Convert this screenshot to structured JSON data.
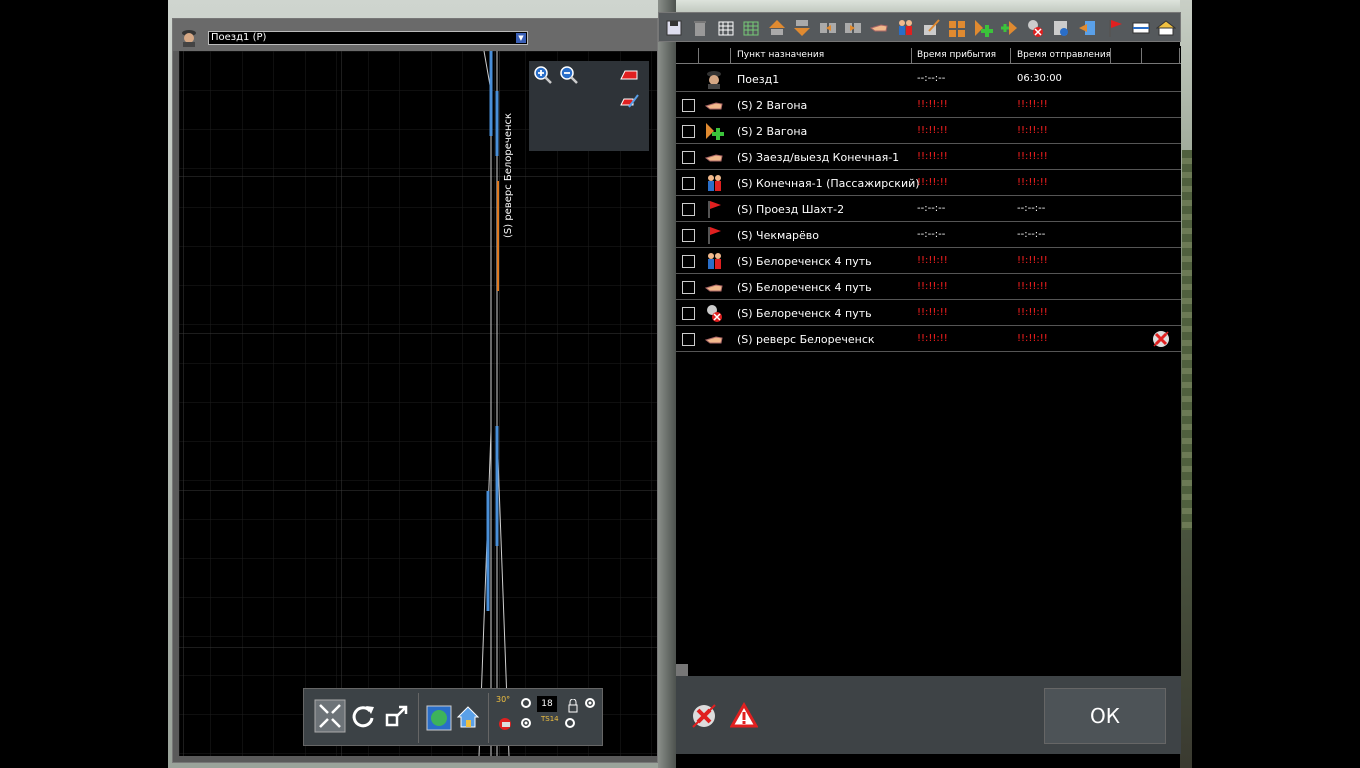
{
  "map": {
    "train_selector": {
      "value": "Поезд1 (P)"
    },
    "track_label": "(S) реверс Белореченск",
    "zoom_in_icon": "zoom-in-icon",
    "zoom_out_icon": "zoom-out-icon"
  },
  "bottom_toolbar": {
    "number_field": "18",
    "rotation_label": "30°",
    "ts_label": "TS14"
  },
  "schedule": {
    "columns": {
      "destination": "Пункт назначения",
      "arrival": "Время прибытия",
      "departure": "Время отправления"
    },
    "header_row": {
      "name": "Поезд1",
      "arrival": "--:--:--",
      "departure": "06:30:00"
    },
    "rows": [
      {
        "icon": "hand-icon",
        "name": "(S) 2 Вагона",
        "arrival": "!!:!!:!!",
        "departure": "!!:!!:!!",
        "alert": true
      },
      {
        "icon": "add-car-icon",
        "name": "(S) 2 Вагона",
        "arrival": "!!:!!:!!",
        "departure": "!!:!!:!!",
        "alert": true
      },
      {
        "icon": "hand-icon",
        "name": "(S) Заезд/выезд Конечная-1",
        "arrival": "!!:!!:!!",
        "departure": "!!:!!:!!",
        "alert": true
      },
      {
        "icon": "passengers-icon",
        "name": "(S) Конечная-1 (Пассажирский)",
        "arrival": "!!:!!:!!",
        "departure": "!!:!!:!!",
        "alert": true
      },
      {
        "icon": "flag-icon",
        "name": "(S) Проезд Шахт-2",
        "arrival": "--:--:--",
        "departure": "--:--:--",
        "alert": false
      },
      {
        "icon": "flag-icon",
        "name": "(S) Чекмарёво",
        "arrival": "--:--:--",
        "departure": "--:--:--",
        "alert": false
      },
      {
        "icon": "passengers-icon",
        "name": "(S) Белореченск 4 путь",
        "arrival": "!!:!!:!!",
        "departure": "!!:!!:!!",
        "alert": true
      },
      {
        "icon": "hand-icon",
        "name": "(S) Белореченск 4 путь",
        "arrival": "!!:!!:!!",
        "departure": "!!:!!:!!",
        "alert": true
      },
      {
        "icon": "uncouple-icon",
        "name": "(S) Белореченск 4 путь",
        "arrival": "!!:!!:!!",
        "departure": "!!:!!:!!",
        "alert": true
      },
      {
        "icon": "hand-icon",
        "name": "(S) реверс Белореченск",
        "arrival": "!!:!!:!!",
        "departure": "!!:!!:!!",
        "alert": true
      }
    ]
  },
  "footer": {
    "ok_label": "ОК"
  },
  "colors": {
    "alert_red": "#ff2020",
    "accent_blue": "#4a8fd8",
    "track_orange": "#e07a20"
  }
}
